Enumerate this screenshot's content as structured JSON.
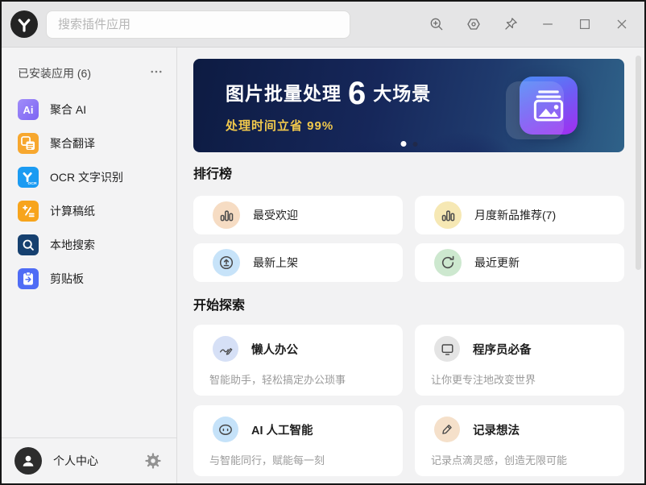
{
  "topbar": {
    "search_placeholder": "搜索插件应用",
    "icons": [
      "zoom-in-icon",
      "hexagon-panel-icon",
      "pin-icon",
      "minimize-icon",
      "maximize-icon",
      "close-icon"
    ]
  },
  "sidebar": {
    "header": "已安装应用 (6)",
    "items": [
      {
        "label": "聚合 AI",
        "icon": "ai-icon",
        "icon_bg": "#8f7bf7",
        "icon_text": "Ai"
      },
      {
        "label": "聚合翻译",
        "icon": "translate-icon",
        "icon_bg": "#f7a72e"
      },
      {
        "label": "OCR 文字识别",
        "icon": "ocr-icon",
        "icon_bg": "#1b9bf2",
        "icon_text": "OCR"
      },
      {
        "label": "计算稿纸",
        "icon": "calc-icon",
        "icon_bg": "#f7a41c"
      },
      {
        "label": "本地搜索",
        "icon": "local-search-icon",
        "icon_bg": "#16406f"
      },
      {
        "label": "剪贴板",
        "icon": "clipboard-icon",
        "icon_bg": "#4f6cf5"
      }
    ],
    "footer": {
      "label": "个人中心"
    }
  },
  "banner": {
    "title_prefix": "图片批量处理",
    "title_big": "6",
    "title_suffix": "大场景",
    "subtitle": "处理时间立省 99%",
    "dots_total": 2,
    "active_dot": 1,
    "colors": {
      "gradient_start": "#0d1b42",
      "gradient_end": "#2f6289",
      "subtitle": "#f2c94c",
      "app_icon_start": "#4b8cf7",
      "app_icon_end": "#a32df0"
    }
  },
  "rank": {
    "title": "排行榜",
    "cards": [
      {
        "label": "最受欢迎",
        "icon": "bar-chart-icon",
        "icon_bg": "#f6dcc3"
      },
      {
        "label": "月度新品推荐(7)",
        "icon": "bar-chart-icon",
        "icon_bg": "#f6e8b4"
      },
      {
        "label": "最新上架",
        "icon": "upload-circle-icon",
        "icon_bg": "#c7e3f9"
      },
      {
        "label": "最近更新",
        "icon": "refresh-icon",
        "icon_bg": "#cde8cf"
      }
    ]
  },
  "explore": {
    "title": "开始探索",
    "cards": [
      {
        "label": "懒人办公",
        "desc": "智能助手，轻松搞定办公琐事",
        "icon": "pen-chart-icon",
        "icon_bg": "#d6e0f6"
      },
      {
        "label": "程序员必备",
        "desc": "让你更专注地改变世界",
        "icon": "monitor-icon",
        "icon_bg": "#e4e4e4"
      },
      {
        "label": "AI 人工智能",
        "desc": "与智能同行，赋能每一刻",
        "icon": "robot-icon",
        "icon_bg": "#c5e2f9"
      },
      {
        "label": "记录想法",
        "desc": "记录点滴灵感，创造无限可能",
        "icon": "pencil-icon",
        "icon_bg": "#f5e0ca"
      }
    ]
  }
}
